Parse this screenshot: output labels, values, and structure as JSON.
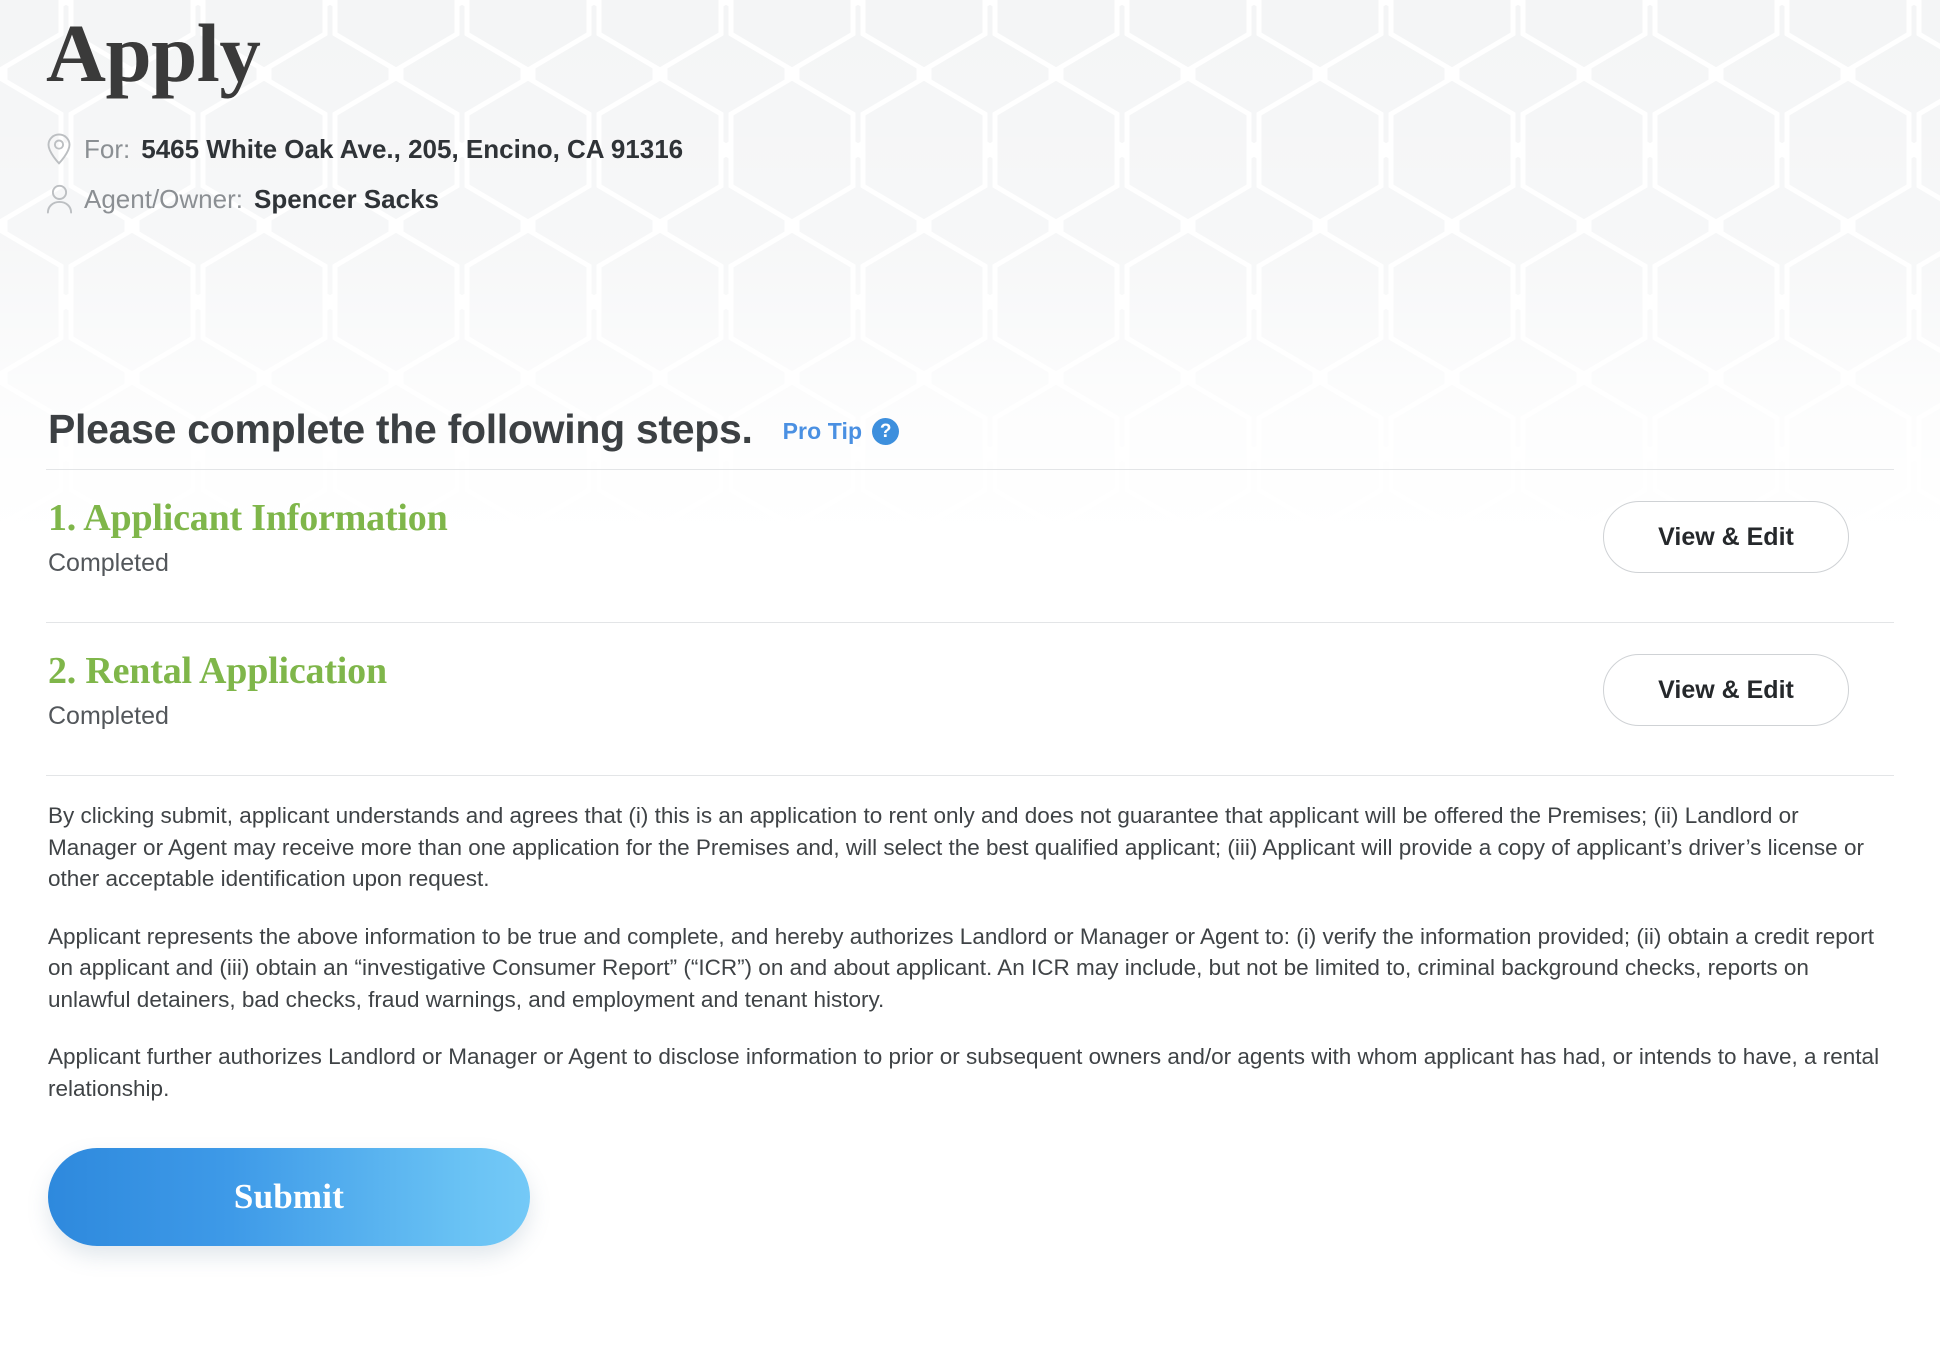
{
  "header": {
    "title": "Apply",
    "property": {
      "icon": "map-pin-icon",
      "label": "For:",
      "value": "5465 White Oak Ave., 205, Encino, CA 91316"
    },
    "agent": {
      "icon": "person-icon",
      "label": "Agent/Owner:",
      "value": "Spencer Sacks"
    }
  },
  "steps_section": {
    "heading": "Please complete the following steps.",
    "pro_tip_label": "Pro Tip",
    "help_icon_glyph": "?",
    "steps": [
      {
        "title": "1. Applicant Information",
        "status": "Completed",
        "button_label": "View & Edit"
      },
      {
        "title": "2. Rental Application",
        "status": "Completed",
        "button_label": "View & Edit"
      }
    ]
  },
  "legal": {
    "paragraphs": [
      "By clicking submit, applicant understands and agrees that (i) this is an application to rent only and does not guarantee that applicant will be offered the Premises; (ii) Landlord or Manager or Agent may receive more than one application for the Premises and, will select the best qualified applicant; (iii) Applicant will provide a copy of applicant’s driver’s license or other acceptable identification upon request.",
      "Applicant represents the above information to be true and complete, and hereby authorizes Landlord or Manager or Agent to: (i) verify the information provided; (ii) obtain a credit report on applicant and (iii) obtain an “investigative Consumer Report” (“ICR”) on and about applicant. An ICR may include, but not be limited to, criminal background checks, reports on unlawful detainers, bad checks, fraud warnings, and employment and tenant history.",
      "Applicant further authorizes Landlord or Manager or Agent to disclose information to prior or subsequent owners and/or agents with whom applicant has had, or intends to have, a rental relationship."
    ]
  },
  "submit": {
    "label": "Submit"
  },
  "colors": {
    "step_green": "#7fb64a",
    "pro_tip_blue": "#4a90e2",
    "submit_gradient_start": "#2e89dd",
    "submit_gradient_end": "#74c9f7",
    "heading_gray": "#3c4043"
  }
}
